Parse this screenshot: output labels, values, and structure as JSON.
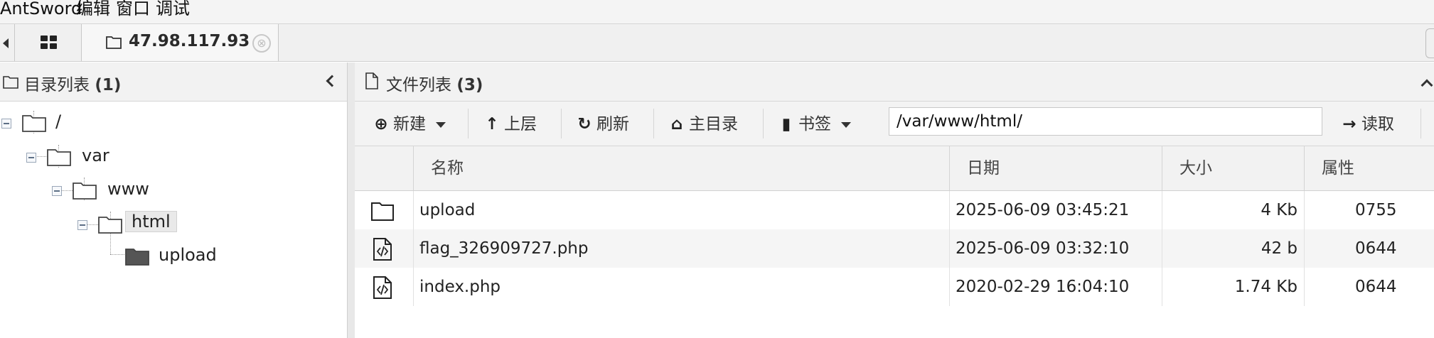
{
  "menu": {
    "items": [
      "AntSword",
      "编辑",
      "窗口",
      "调试"
    ]
  },
  "tabs": {
    "active_title": "47.98.117.93",
    "close_glyph": "⊗"
  },
  "left_panel": {
    "title": "目录列表",
    "count": "(1)",
    "tree": [
      {
        "label": "/",
        "level": 0
      },
      {
        "label": "var",
        "level": 1
      },
      {
        "label": "www",
        "level": 2
      },
      {
        "label": "html",
        "level": 3,
        "selected": true
      },
      {
        "label": "upload",
        "level": 4
      }
    ]
  },
  "right_panel": {
    "title": "文件列表",
    "count": "(3)",
    "toolbar": {
      "new_label": "新建",
      "up_label": "上层",
      "refresh_label": "刷新",
      "home_label": "主目录",
      "bookmark_label": "书签",
      "path_value": "/var/www/html/",
      "read_label": "读取"
    },
    "columns": {
      "name": "名称",
      "date": "日期",
      "size": "大小",
      "attr": "属性"
    },
    "files": [
      {
        "type": "folder",
        "name": "upload",
        "date": "2025-06-09 03:45:21",
        "size": "4 Kb",
        "attr": "0755"
      },
      {
        "type": "php",
        "name": "flag_326909727.php",
        "date": "2025-06-09 03:32:10",
        "size": "42 b",
        "attr": "0644"
      },
      {
        "type": "php",
        "name": "index.php",
        "date": "2020-02-29 16:04:10",
        "size": "1.74 Kb",
        "attr": "0644"
      }
    ]
  },
  "icons": {
    "grid": "grid-icon",
    "folder": "folder-icon",
    "folder_filled": "folder-filled-icon",
    "file_code": "file-code-icon",
    "plus": "plus-circle-icon",
    "arrow_up": "arrow-up-icon",
    "refresh": "refresh-icon",
    "home": "home-icon",
    "bookmark": "bookmark-icon",
    "arrow_right": "arrow-right-icon"
  }
}
